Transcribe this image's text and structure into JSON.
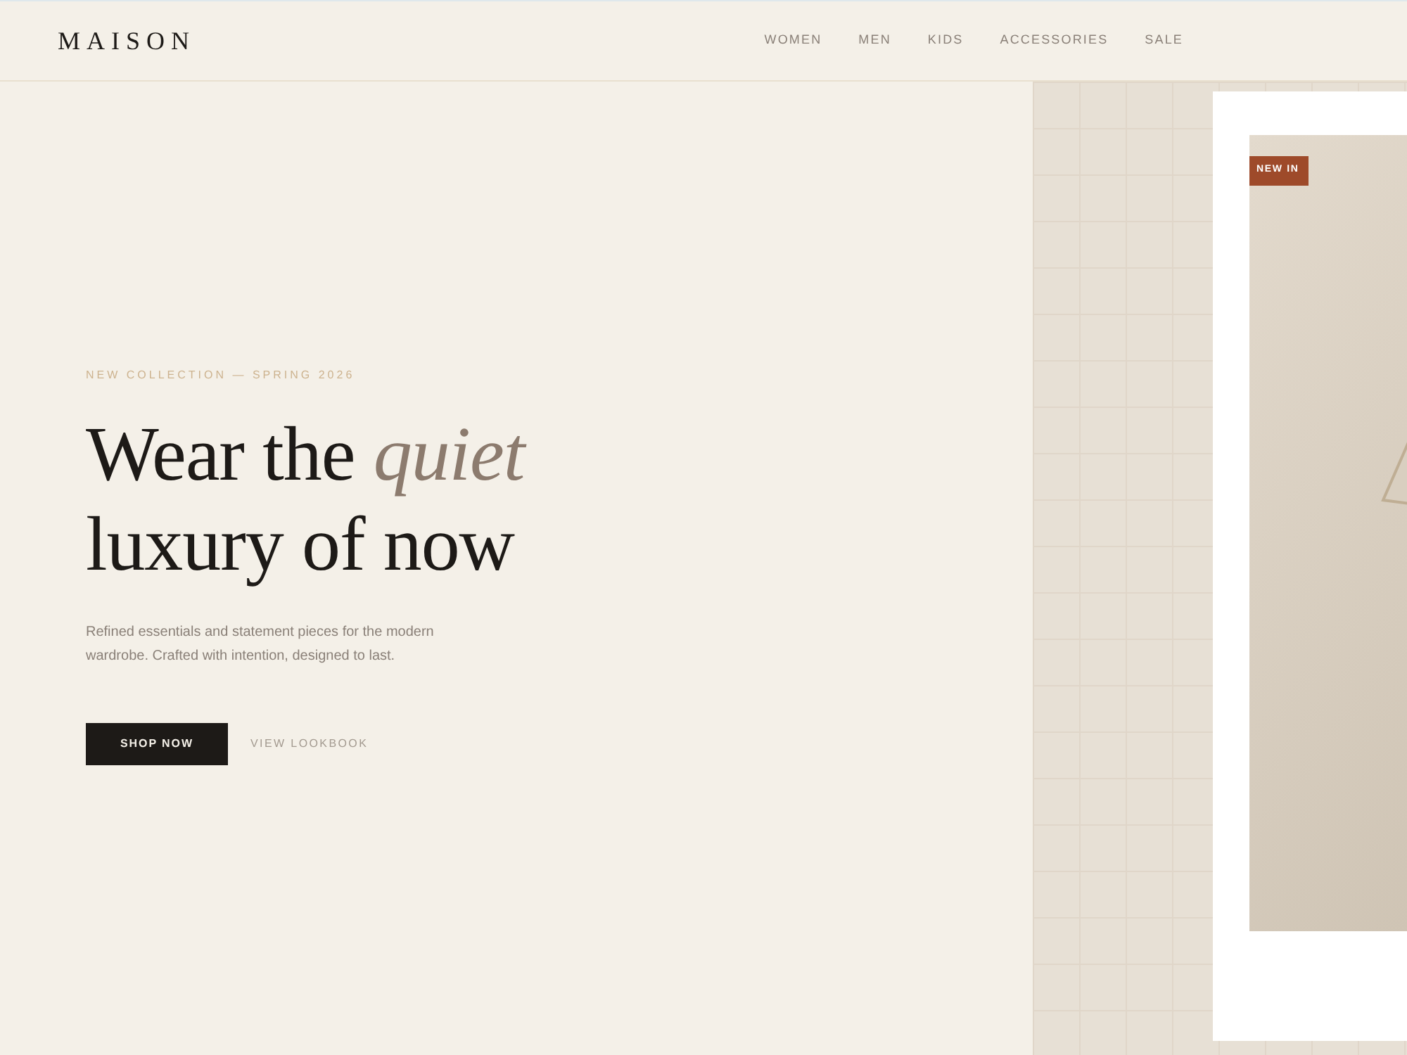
{
  "brand": "MAISON",
  "nav": [
    "WOMEN",
    "MEN",
    "KIDS",
    "ACCESSORIES",
    "SALE"
  ],
  "hero": {
    "eyebrow": "NEW COLLECTION — SPRING 2026",
    "headline_line_1": "Wear the *quiet*",
    "headline_line_2": "luxury of now",
    "description": "Refined essentials and statement pieces for the modern wardrobe. Crafted with intention, designed to last.",
    "primary_button": "SHOP NOW",
    "secondary_link": "VIEW LOOKBOOK"
  },
  "product_card": {
    "badge": "NEW IN"
  }
}
